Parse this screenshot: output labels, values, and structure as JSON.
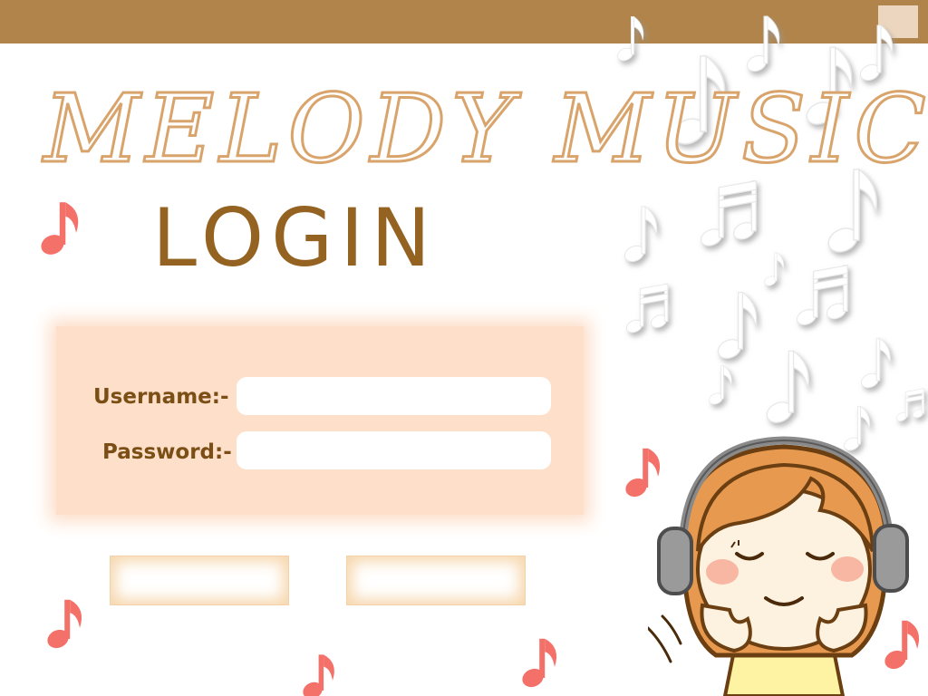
{
  "header": {
    "brand_title": "MELODY MUSIC",
    "page_title": "LOGIN"
  },
  "form": {
    "username_label": "Username:-",
    "username_value": "",
    "password_label": "Password:-",
    "password_value": ""
  },
  "buttons": {
    "left_label": "",
    "right_label": ""
  },
  "icons": {
    "window_button": "window-control-icon",
    "notes": "music-note-icon",
    "illustration": "girl-with-headphones"
  },
  "colors": {
    "title_bar": "#b0844a",
    "brand": "#d9a46b",
    "login_title": "#946322",
    "panel": "#fddfca",
    "label": "#7a4e14",
    "note_red": "#f4716a"
  }
}
